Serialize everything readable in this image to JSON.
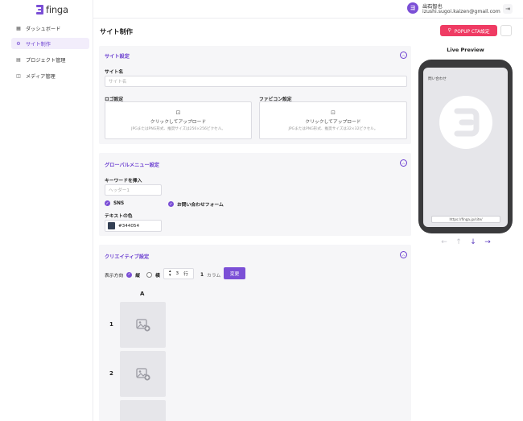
{
  "brand": {
    "name": "finga",
    "accent": "#7b4fd6",
    "danger": "#ef3b63"
  },
  "sidebar": {
    "items": [
      {
        "label": "ダッシュボード",
        "icon": "grid-icon"
      },
      {
        "label": "サイト制作",
        "icon": "sitemap-icon",
        "active": true
      },
      {
        "label": "プロジェクト管理",
        "icon": "table-icon"
      },
      {
        "label": "メディア管理",
        "icon": "media-icon"
      }
    ]
  },
  "header": {
    "user_name": "出石智也",
    "user_email": "izushi.sugoi.kaizen@gmail.com",
    "avatar_letter": "ヨ"
  },
  "page": {
    "title": "サイト制作",
    "popup_button": "POPUP CTA設定"
  },
  "site_settings": {
    "title": "サイト設定",
    "site_name_label": "サイト名",
    "site_name_placeholder": "サイト名",
    "logo_label": "ロゴ設定",
    "favicon_label": "ファビコン設定",
    "upload_text": "クリックしてアップロード",
    "logo_hint": "JPGまたはPNG形式、推奨サイズは256×256ピクセル。",
    "favicon_hint": "JPGまたはPNG形式、推奨サイズは32×32ピクセル。"
  },
  "global_menu": {
    "title": "グローバルメニュー設定",
    "keyword_label": "キーワードを挿入",
    "keyword_placeholder": "ヘッダー1",
    "sns_label": "SNS",
    "contact_label": "お問い合わせフォーム",
    "text_color_label": "テキストの色",
    "text_color_value": "#344054"
  },
  "creative": {
    "title": "クリエイティブ設定",
    "direction_label": "表示方向",
    "vertical_label": "縦",
    "horizontal_label": "横",
    "rows_value": "3",
    "rows_unit": "行",
    "columns_value": "1",
    "columns_unit": "カラム",
    "change_button": "変更",
    "column_header": "A",
    "row_numbers": [
      "1",
      "2"
    ]
  },
  "preview": {
    "title": "Live Preview",
    "screen_text": "問い合わせ",
    "url": "https://finga.jp/site/"
  }
}
